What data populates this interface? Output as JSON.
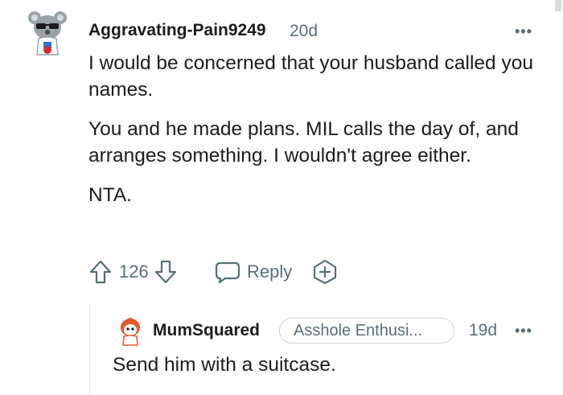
{
  "comment": {
    "username": "Aggravating-Pain9249",
    "age": "20d",
    "paragraphs": [
      "I would be concerned that your husband called you names.",
      "You and he made plans. MIL calls the day of, and arranges something. I wouldn't agree either.",
      "NTA."
    ],
    "score": "126",
    "reply_label": "Reply",
    "more_label": "•••"
  },
  "reply": {
    "username": "MumSquared",
    "flair": "Asshole Enthusi...",
    "age": "19d",
    "text": "Send him with a suitcase.",
    "more_label": "•••"
  },
  "icons": [
    "avatar",
    "upvote-icon",
    "downvote-icon",
    "comment-bubble-icon",
    "award-icon",
    "more-options-icon"
  ],
  "colors": {
    "text": "#1c1c1c",
    "muted": "#576f76",
    "border": "#ced3d6"
  }
}
